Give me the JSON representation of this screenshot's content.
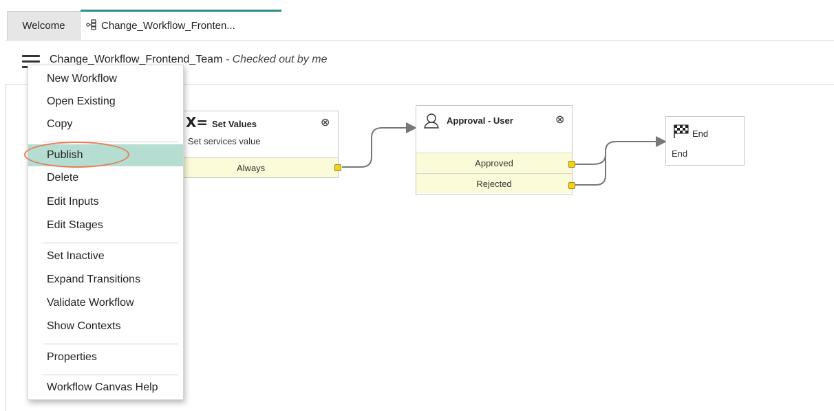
{
  "tabs": {
    "welcome": "Welcome",
    "active": "Change_Workflow_Fronten..."
  },
  "header": {
    "title": "Change_Workflow_Frontend_Team",
    "subtitle": " - Checked out by me"
  },
  "activities": {
    "set_values": {
      "icon": "X=",
      "title": "Set Values",
      "subtitle": "Set services value",
      "conditions": [
        "Always"
      ]
    },
    "approval": {
      "title": "Approval - User",
      "conditions": [
        "Approved",
        "Rejected"
      ]
    },
    "end": {
      "title": "End",
      "subtitle": "End"
    }
  },
  "menu": {
    "items": [
      "New Workflow",
      "Open Existing",
      "Copy",
      "Publish",
      "Delete",
      "Edit Inputs",
      "Edit Stages",
      "Set Inactive",
      "Expand Transitions",
      "Validate Workflow",
      "Show Contexts",
      "Properties",
      "Workflow Canvas Help"
    ],
    "highlighted": "Publish"
  },
  "colors": {
    "accent": "#278e81",
    "menu_highlight": "#b5ddd2",
    "annotation": "#e87a52",
    "condition_bg": "#fbfbd9",
    "port": "#f2d21b"
  }
}
